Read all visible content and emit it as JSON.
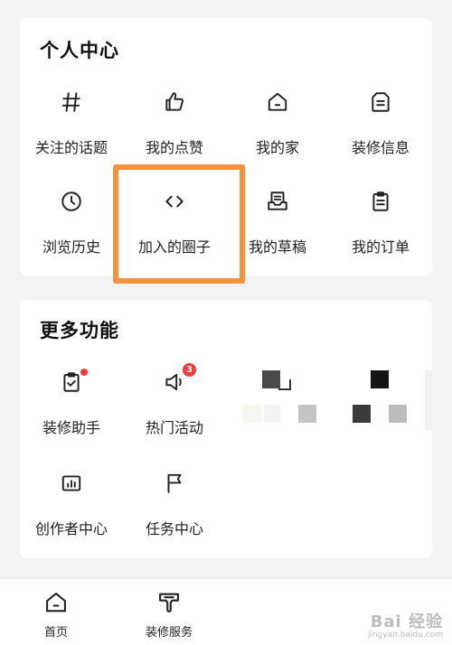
{
  "personal_center": {
    "title": "个人中心",
    "items": [
      {
        "label": "关注的话题",
        "icon": "hashtag-icon"
      },
      {
        "label": "我的点赞",
        "icon": "thumbs-up-icon"
      },
      {
        "label": "我的家",
        "icon": "home-icon"
      },
      {
        "label": "装修信息",
        "icon": "info-file-icon"
      },
      {
        "label": "浏览历史",
        "icon": "clock-icon"
      },
      {
        "label": "加入的圈子",
        "icon": "code-brackets-icon"
      },
      {
        "label": "我的草稿",
        "icon": "draft-box-icon"
      },
      {
        "label": "我的订单",
        "icon": "clipboard-icon"
      }
    ]
  },
  "more_features": {
    "title": "更多功能",
    "items": [
      {
        "label": "装修助手",
        "icon": "clipboard-check-icon"
      },
      {
        "label": "热门活动",
        "icon": "megaphone-icon",
        "badge": "3"
      },
      {
        "label": "创作者中心",
        "icon": "bar-chart-icon"
      },
      {
        "label": "任务中心",
        "icon": "flag-icon"
      }
    ]
  },
  "tabbar": {
    "items": [
      {
        "label": "首页",
        "icon": "home-icon"
      },
      {
        "label": "装修服务",
        "icon": "service-icon"
      }
    ]
  },
  "watermark": {
    "main": "Bai 经验",
    "sub": "jingyan.baidu.com"
  },
  "colors": {
    "highlight": "#f5923e",
    "badge": "#f03a3a",
    "card": "#ffffff",
    "background": "#f4f4f5"
  }
}
